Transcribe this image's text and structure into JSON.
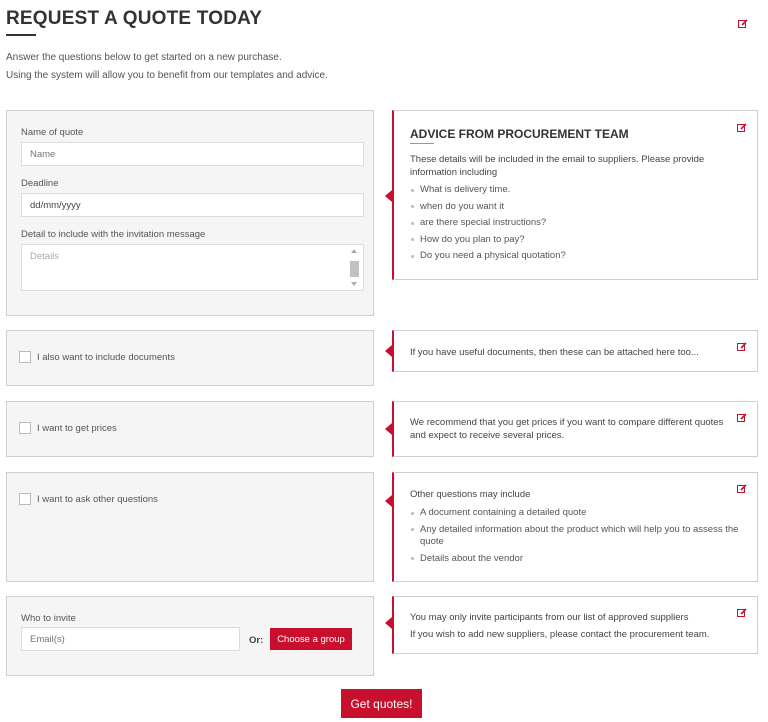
{
  "header": {
    "title": "REQUEST A QUOTE TODAY",
    "intro_line1": "Answer the questions below to get started on a new purchase.",
    "intro_line2": "Using the system will allow you to benefit from our templates and advice."
  },
  "quote_form": {
    "name_label": "Name of quote",
    "name_placeholder": "Name",
    "deadline_label": "Deadline",
    "deadline_value": "dd/mm/yyyy",
    "detail_label": "Detail to include with the invitation message",
    "detail_placeholder": "Details"
  },
  "advice_main": {
    "title": "ADVICE FROM PROCUREMENT TEAM",
    "text": "These details will be included in the email to suppliers. Please provide information including",
    "items": [
      "What is delivery time.",
      "when do you want it",
      "are there special instructions?",
      "How do you plan to pay?",
      "Do you need a physical quotation?"
    ]
  },
  "documents": {
    "checkbox_label": "I also want to include documents",
    "advice": "If you have useful documents, then these can be attached here too..."
  },
  "prices": {
    "checkbox_label": "I want to get prices",
    "advice": "We recommend that you get prices if you want to compare different quotes and expect to receive several prices."
  },
  "questions": {
    "checkbox_label": "I want to ask other questions",
    "advice": "Other questions may include",
    "items": [
      "A document containing a detailed quote",
      "Any detailed information about the product which will help you to assess the quote",
      "Details about the vendor"
    ]
  },
  "invite": {
    "label": "Who to invite",
    "email_placeholder": "Email(s)",
    "or_label": "Or:",
    "group_button": "Choose a group",
    "advice_line1": "You may only invite participants from our list of approved suppliers",
    "advice_line2": "If you wish to add new suppliers, please contact the procurement team."
  },
  "submit_label": "Get quotes!",
  "icons": {
    "edit": "edit-icon"
  },
  "colors": {
    "accent": "#c8102e",
    "panel_bg": "#f5f5f5"
  }
}
